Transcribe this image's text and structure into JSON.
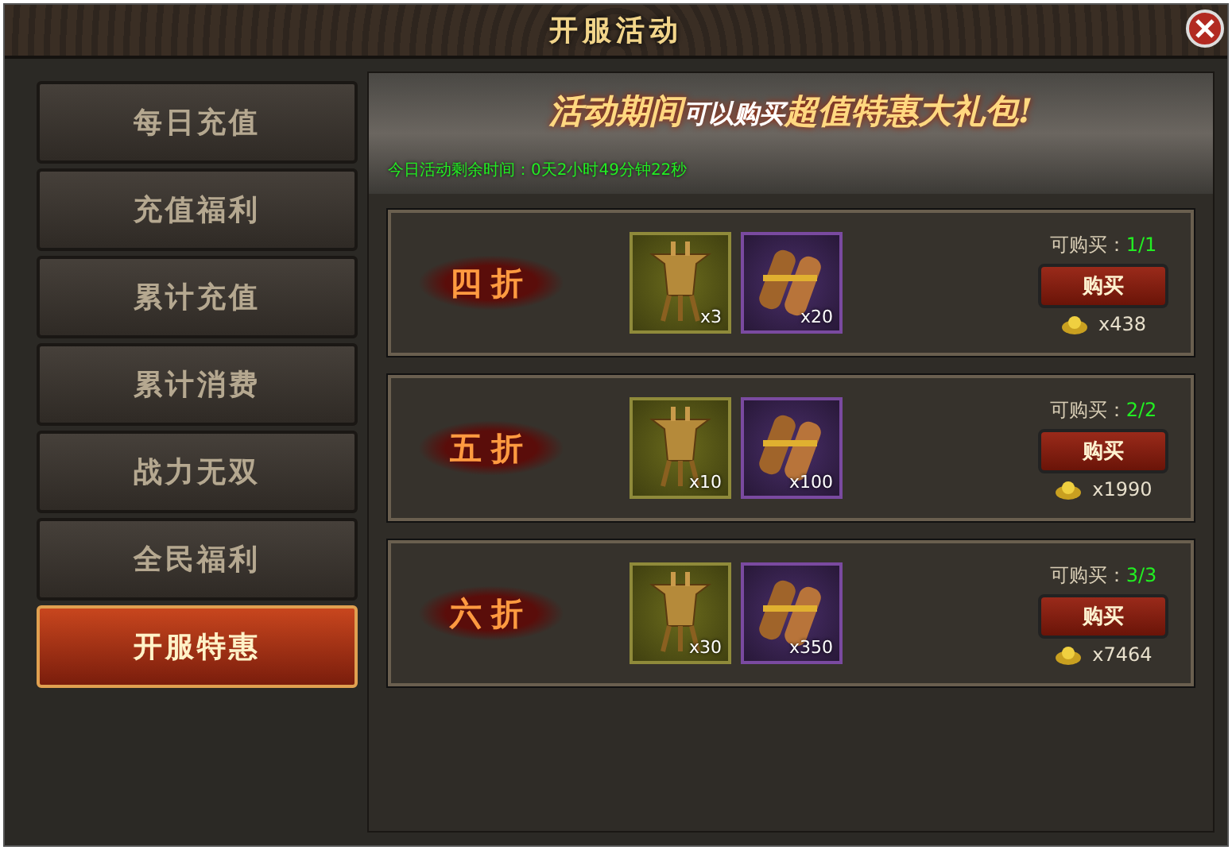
{
  "window": {
    "title": "开服活动"
  },
  "sidebar": {
    "items": [
      {
        "label": "每日充值",
        "selected": false
      },
      {
        "label": "充值福利",
        "selected": false
      },
      {
        "label": "累计充值",
        "selected": false
      },
      {
        "label": "累计消费",
        "selected": false
      },
      {
        "label": "战力无双",
        "selected": false
      },
      {
        "label": "全民福利",
        "selected": false
      },
      {
        "label": "开服特惠",
        "selected": true
      }
    ]
  },
  "banner": {
    "title_parts": [
      "活动期间",
      "可以购买",
      "超值特惠大礼包!"
    ],
    "countdown": "今日活动剩余时间：0天2小时49分钟22秒"
  },
  "offers": [
    {
      "discount": "四折",
      "items": [
        {
          "kind": "vessel",
          "count": "x3"
        },
        {
          "kind": "scroll",
          "count": "x20"
        }
      ],
      "limit_label": "可购买：",
      "limit": "1/1",
      "button": "购买",
      "price": "x438"
    },
    {
      "discount": "五折",
      "items": [
        {
          "kind": "vessel",
          "count": "x10"
        },
        {
          "kind": "scroll",
          "count": "x100"
        }
      ],
      "limit_label": "可购买：",
      "limit": "2/2",
      "button": "购买",
      "price": "x1990"
    },
    {
      "discount": "六折",
      "items": [
        {
          "kind": "vessel",
          "count": "x30"
        },
        {
          "kind": "scroll",
          "count": "x350"
        }
      ],
      "limit_label": "可购买：",
      "limit": "3/3",
      "button": "购买",
      "price": "x7464"
    }
  ]
}
